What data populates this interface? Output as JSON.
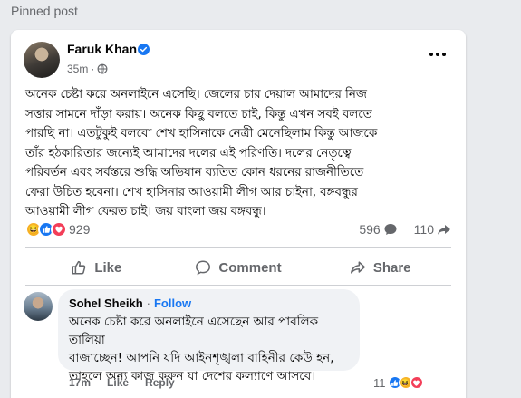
{
  "section": {
    "title": "Pinned post"
  },
  "post": {
    "author": "Faruk Khan",
    "time": "35m",
    "privacy_separator": "·",
    "body": "অনেক চেষ্টা করে অনলাইনে এসেছি। জেলের চার দেয়াল আমাদের নিজ\nসত্তার সামনে দাঁড়া করায়। অনেক কিছু বলতে চাই, কিন্তু এখন সবই বলতে\nপারছি না। এতটুকুই বলবো শেখ হাসিনাকে নেত্রী মেনেছিলাম কিন্তু আজকে\nতাঁর হঠকারিতার জন্যেই আমাদের দলের এই পরিণতি। দলের নেতৃত্বে\nপরিবর্তন এবং সর্বস্তরে শুদ্ধি অভিযান ব্যতিত কোন ধরনের রাজনীতিতে\nফেরা উচিত হবেনা। শেখ হাসিনার আওয়ামী লীগ আর চাইনা, বঙ্গবন্ধুর\nআওয়ামী লীগ ফেরত চাই। জয় বাংলা জয় বঙ্গবন্ধু।",
    "reaction_count": "929",
    "comment_count": "596",
    "share_count": "110",
    "icons": {
      "verified": "verified-badge-icon",
      "globe": "globe-icon",
      "more": "more-options-icon",
      "comment_count": "comment-bubble-icon",
      "share_count": "share-arrow-icon"
    }
  },
  "actions": {
    "like": "Like",
    "comment": "Comment",
    "share": "Share"
  },
  "comment": {
    "author": "Sohel Sheikh",
    "separator": "·",
    "follow": "Follow",
    "text": "অনেক চেষ্টা করে অনলাইনে এসেছেন আর পাবলিক তালিয়া\nবাজাচ্ছেন! আপনি যদি আইনশৃঙ্খলা বাহিনীর কেউ হন,\nতাহলে অন্য কাজ করুন যা দেশের কল্যাণে আসবে।",
    "time": "17m",
    "like": "Like",
    "reply": "Reply",
    "reaction_count": "11"
  },
  "colors": {
    "accent": "#1877f2",
    "muted_text": "#65676b",
    "haha": "#f7b125",
    "love": "#f33e58"
  }
}
